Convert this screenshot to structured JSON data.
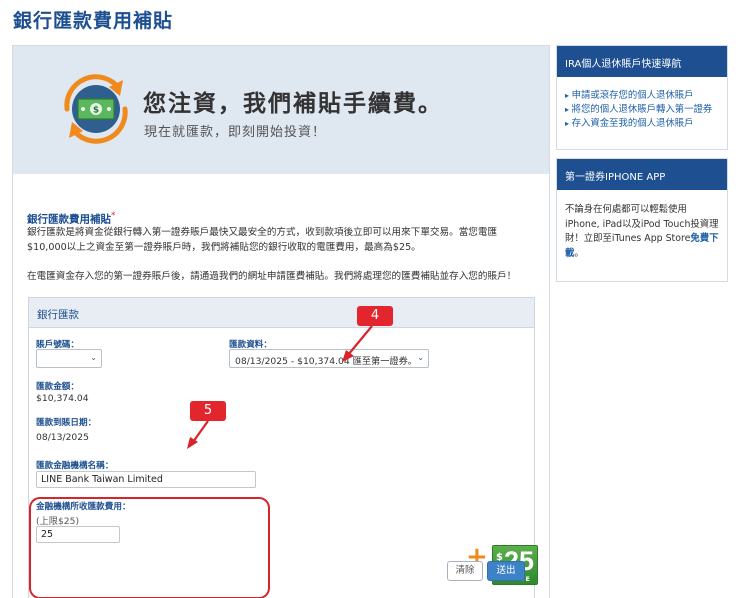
{
  "page": {
    "title": "銀行匯款費用補貼"
  },
  "hero": {
    "title": "您注資，我們補貼手續費。",
    "subtitle": "現在就匯款，即刻開始投資！"
  },
  "intro": {
    "title": "銀行匯款費用補貼",
    "asterisk": "*",
    "paragraph1": "銀行匯款是將資金從銀行轉入第一證券賬戶最快又最安全的方式，收到款項後立即可以用來下單交易。當您電匯$10,000以上之資金至第一證券賬戶時，我們將補貼您的銀行收取的電匯費用，最高為$25。",
    "paragraph2": "在電匯資金存入您的第一證券賬戶後，請通過我們的網址申請匯費補貼。我們將處理您的匯費補貼並存入您的賬戶！"
  },
  "wire_form": {
    "header": "銀行匯款",
    "account_label": "賬戶號碼：",
    "account_value": "",
    "wire_info_label": "匯款資料：",
    "wire_info_value": "08/13/2025 - $10,374.04 匯至第一證券。",
    "amount_label": "匯款金額：",
    "amount_value": "$10,374.04",
    "date_label": "匯款到賬日期：",
    "date_value": "08/13/2025",
    "institution_label": "匯款金融機構名稱：",
    "institution_value": "LINE Bank Taiwan Limited",
    "fee_label": "金融機構所收匯款費用：",
    "fee_limit": "(上限$25)",
    "fee_value": "25",
    "clear_label": "清除",
    "submit_label": "送出",
    "rebate_dollar": "$",
    "rebate_amount": "25",
    "rebate_tag": "REBATE",
    "plus": "+"
  },
  "callouts": {
    "four": "4",
    "five": "5"
  },
  "sidebar": {
    "ira": {
      "title": "IRA個人退休賬戶快速導航",
      "links": [
        "申請或滾存您的個人退休賬戶",
        "將您的個人退休賬戶轉入第一證券",
        "存入資金至我的個人退休賬戶"
      ]
    },
    "app": {
      "title": "第一證券IPHONE APP",
      "text": "不論身在何處都可以輕鬆使用iPhone, iPad以及iPod Touch投資理財！立即至iTunes App Store",
      "link": "免費下載",
      "end": "。"
    }
  },
  "colors": {
    "brand": "#1d4f91",
    "accent_red": "#e3262e",
    "orange": "#f08a1d",
    "green": "#3f9a38"
  }
}
